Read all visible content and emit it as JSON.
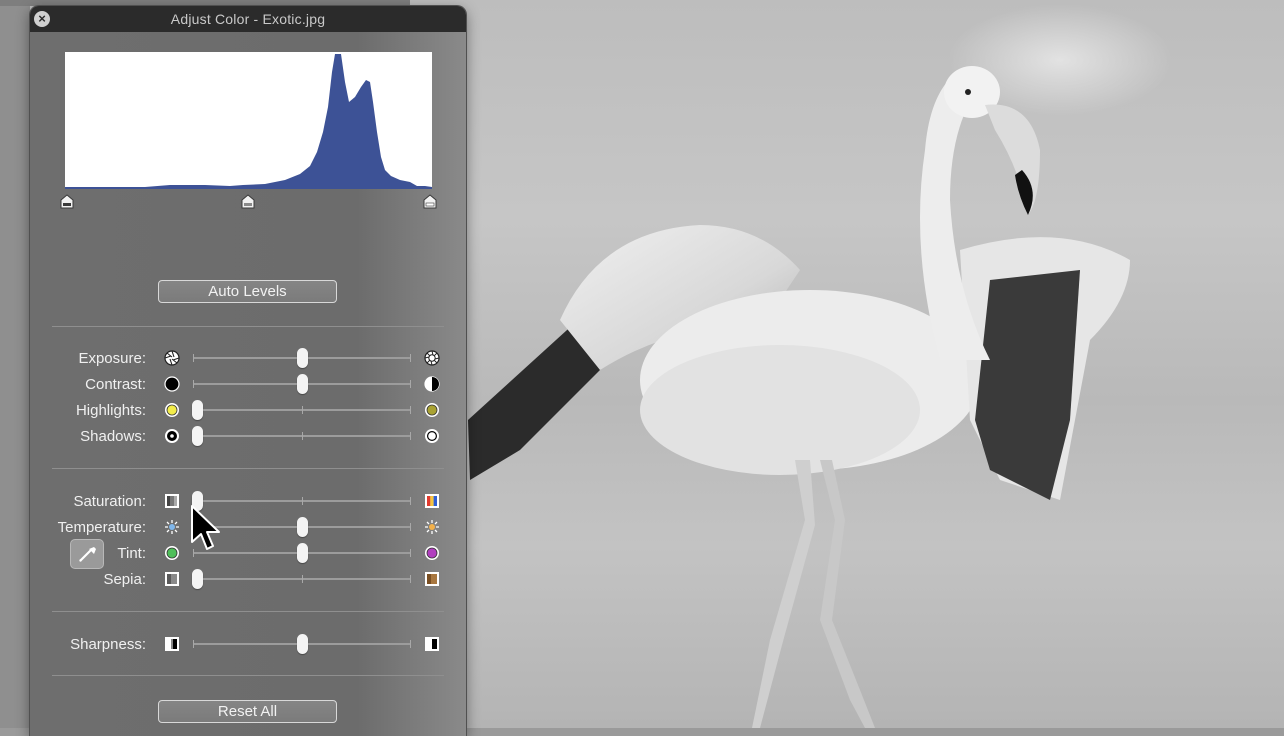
{
  "window": {
    "title": "Adjust Color - Exotic.jpg",
    "close_icon": "close-icon"
  },
  "histogram": {
    "black_point": 0.0,
    "gray_point": 0.5,
    "white_point": 1.0
  },
  "buttons": {
    "auto_levels": "Auto Levels",
    "reset_all": "Reset All"
  },
  "sliders": {
    "exposure": {
      "label": "Exposure:",
      "value": 0.5,
      "left_icon": "aperture-closed-icon",
      "right_icon": "aperture-open-icon"
    },
    "contrast": {
      "label": "Contrast:",
      "value": 0.5,
      "left_icon": "black-circle-icon",
      "right_icon": "half-circle-icon"
    },
    "highlights": {
      "label": "Highlights:",
      "value": 0.02,
      "left_icon": "bright-yellow-dot-icon",
      "right_icon": "dim-yellow-dot-icon"
    },
    "shadows": {
      "label": "Shadows:",
      "value": 0.02,
      "left_icon": "dark-ring-icon",
      "right_icon": "light-ring-icon"
    },
    "saturation": {
      "label": "Saturation:",
      "value": 0.02,
      "left_icon": "grayscale-swatch-icon",
      "right_icon": "color-swatch-icon"
    },
    "temperature": {
      "label": "Temperature:",
      "value": 0.5,
      "left_icon": "cool-sun-icon",
      "right_icon": "warm-sun-icon"
    },
    "tint": {
      "label": "Tint:",
      "value": 0.5,
      "left_icon": "green-dot-icon",
      "right_icon": "magenta-dot-icon"
    },
    "sepia": {
      "label": "Sepia:",
      "value": 0.02,
      "left_icon": "gray-swatch-icon",
      "right_icon": "sepia-swatch-icon"
    },
    "sharpness": {
      "label": "Sharpness:",
      "value": 0.5,
      "left_icon": "blur-square-icon",
      "right_icon": "sharp-square-icon"
    }
  },
  "colors": {
    "panel": "#6e6e6e",
    "titlebar": "#2b2b2b",
    "histogram_fill": "#3d5296",
    "text": "#f0f0f0"
  }
}
